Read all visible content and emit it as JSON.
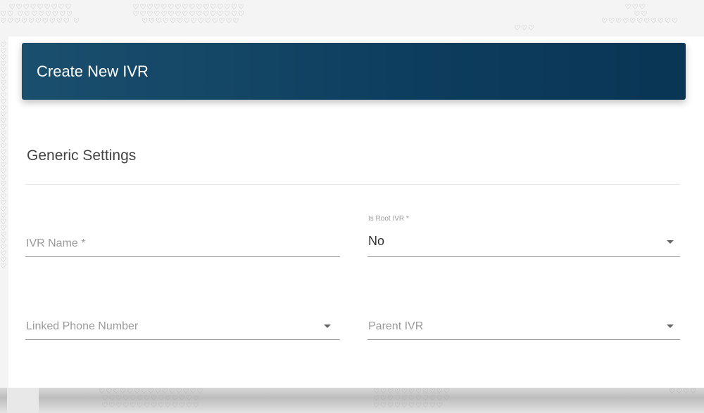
{
  "header": {
    "title": "Create New IVR"
  },
  "section": {
    "title": "Generic Settings"
  },
  "form": {
    "ivr_name": {
      "placeholder": "IVR Name *",
      "value": ""
    },
    "is_root_ivr": {
      "label": "Is Root IVR *",
      "value": "No"
    },
    "linked_phone_number": {
      "placeholder": "Linked Phone Number",
      "value": ""
    },
    "parent_ivr": {
      "placeholder": "Parent IVR",
      "value": ""
    }
  },
  "colors": {
    "header_bg": "#0d3d5e",
    "header_text": "#ffffff",
    "card_bg": "#ffffff"
  },
  "icons": {
    "dropdown": "caret-down-icon",
    "pattern": "heart-pattern-icon"
  }
}
